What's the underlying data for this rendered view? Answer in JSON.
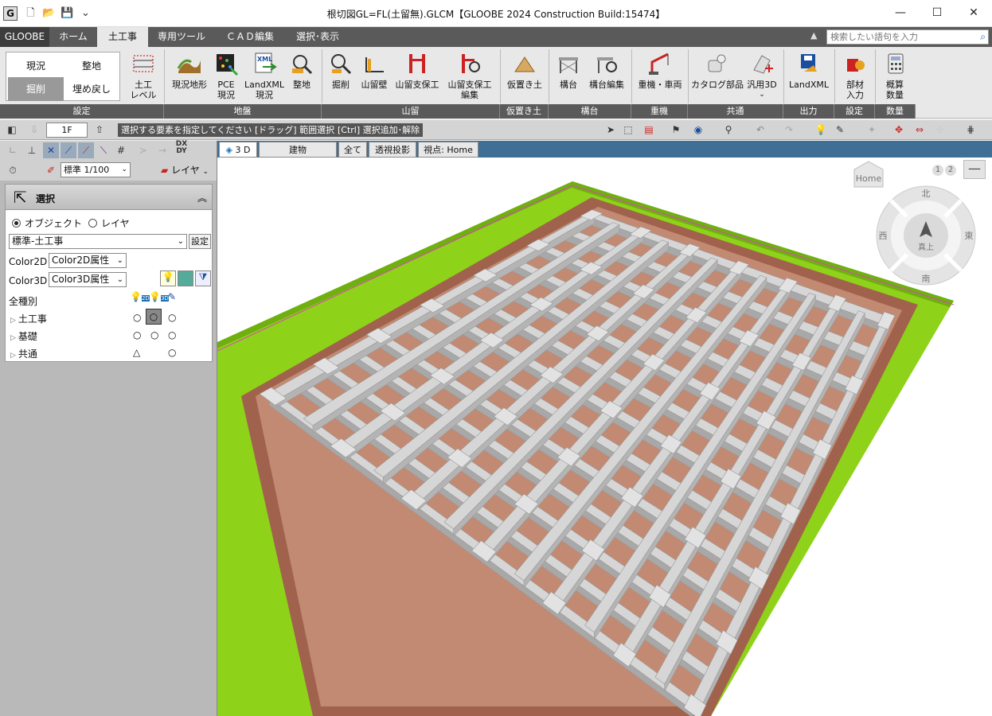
{
  "titlebar": {
    "app_icon": "G",
    "title": "根切図GL=FL(土留無).GLCM【GLOOBE 2024 Construction Build:15474】"
  },
  "tabs": {
    "brand": "GLOOBE",
    "items": [
      "ホーム",
      "土工事",
      "専用ツール",
      "ＣＡＤ編集",
      "選択･表示"
    ],
    "search_placeholder": "検索したい語句を入力"
  },
  "ribbon": {
    "settings": {
      "genkyo": "現況",
      "seichi": "整地",
      "kussaku": "掘削",
      "umemodoshi": "埋め戻し"
    },
    "buttons": {
      "doko_level": "土工\nレベル",
      "genkyo_chikei": "現況地形",
      "pce_genkyo": "PCE\n現況",
      "landxml_genkyo": "LandXML\n現況",
      "seichi": "整地",
      "kussaku": "掘削",
      "yamadome_kabe": "山留壁",
      "yamadome_shihoko": "山留支保工",
      "yamadome_shihoko_henshu": "山留支保工\n編集",
      "karioki_do": "仮置き土",
      "sandai": "構台",
      "sandai_henshu": "構台編集",
      "juki_sharyo": "重機・車両",
      "catalog_buhin": "カタログ部品",
      "hanyo_3d": "汎用3D",
      "landxml": "LandXML",
      "buzai_nyuryoku": "部材\n入力",
      "gaisan_suryo": "概算\n数量"
    },
    "groups": [
      "設定",
      "地盤",
      "山留",
      "仮置き土",
      "構台",
      "重機",
      "共通",
      "出力",
      "設定",
      "数量"
    ]
  },
  "toolbar": {
    "floor": "1F",
    "hint1": "選択する要素を指定してください。",
    "hint2": "[ドラッグ] 範囲選択",
    "hint3": "[Ctrl] 選択追加･解除"
  },
  "leftpanel": {
    "scale": "標準 1/100",
    "layer_btn": "レイヤ",
    "dxdy": "DX\nDY",
    "panel_title": "選択",
    "radio_object": "オブジェクト",
    "radio_layer": "レイヤ",
    "preset": "標準-土工事",
    "preset_btn": "設定",
    "color2d_label": "Color2D",
    "color2d_value": "Color2D属性",
    "color3d_label": "Color3D",
    "color3d_value": "Color3D属性",
    "all_types": "全種別",
    "tree": [
      {
        "label": "土工事",
        "s1": "○",
        "s2": "○",
        "s3": "○"
      },
      {
        "label": "基礎",
        "s1": "○",
        "s2": "○",
        "s3": "○"
      },
      {
        "label": "共通",
        "s1": "△",
        "s2": "",
        "s3": "○"
      }
    ],
    "badge_2d": "2D",
    "badge_3d": "3D"
  },
  "viewport": {
    "tabs": [
      "3 D",
      "建物",
      "全て",
      "透視投影",
      "視点: Home"
    ],
    "home": "Home",
    "pages": [
      "1",
      "2"
    ],
    "compass": {
      "north": "北",
      "south": "南",
      "east": "東",
      "west": "西",
      "center": "真上"
    },
    "colors": {
      "grass": "#8ed21a",
      "soil": "#b87a62",
      "beam": "#d6d6d6",
      "tab_bar": "#3f6f95"
    }
  }
}
